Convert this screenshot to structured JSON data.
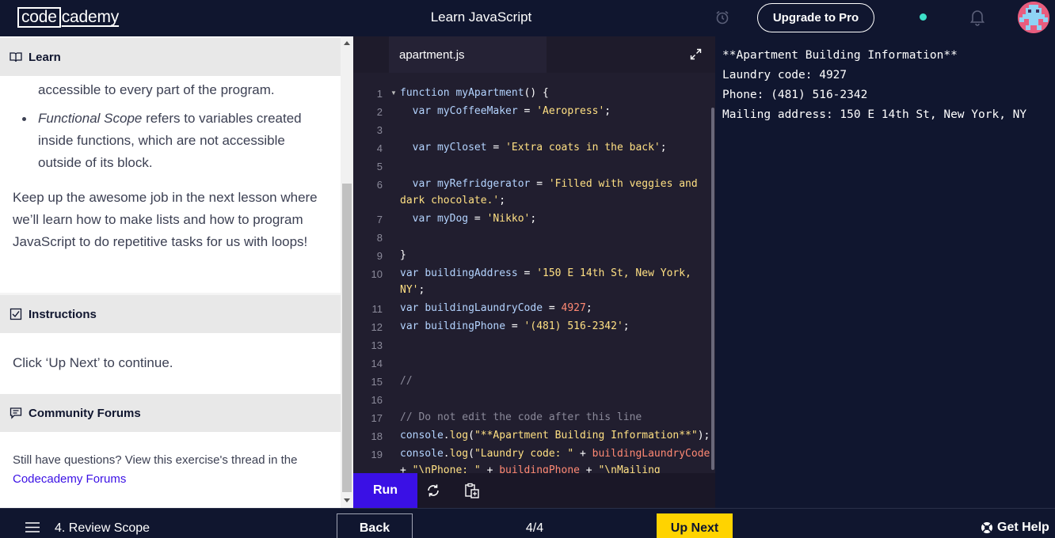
{
  "topbar": {
    "logo_box": "code",
    "logo_rest": "cademy",
    "course_title": "Learn JavaScript",
    "upgrade_label": "Upgrade to Pro"
  },
  "left": {
    "learn_heading": "Learn",
    "partial_line": "accessible to every part of the program.",
    "bullet_em": "Functional Scope",
    "bullet_rest": " refers to variables created inside functions, which are not accessible outside of its block.",
    "paragraph": "Keep up the awesome job in the next lesson where we’ll learn how to make lists and how to program JavaScript to do repetitive tasks for us with loops!",
    "instructions_heading": "Instructions",
    "instructions_text": "Click ‘Up Next’ to continue.",
    "forums_heading": "Community Forums",
    "forums_text": "Still have questions? View this exercise's thread in the",
    "forums_link": "Codecademy Forums"
  },
  "editor": {
    "file_tab": "apartment.js",
    "line_numbers": [
      "1",
      "2",
      "3",
      "4",
      "5",
      "6",
      "7",
      "8",
      "9",
      "10",
      "11",
      "12",
      "13",
      "14",
      "15",
      "16",
      "17",
      "18",
      "19"
    ],
    "run_label": "Run"
  },
  "output": {
    "lines": [
      "**Apartment Building Information**",
      "Laundry code: 4927",
      "Phone: (481) 516-2342",
      "Mailing address: 150 E 14th St, New York, NY"
    ]
  },
  "bottombar": {
    "lesson_title": "4. Review Scope",
    "back_label": "Back",
    "progress": "4/4",
    "next_label": "Up Next",
    "help_label": "Get Help"
  }
}
